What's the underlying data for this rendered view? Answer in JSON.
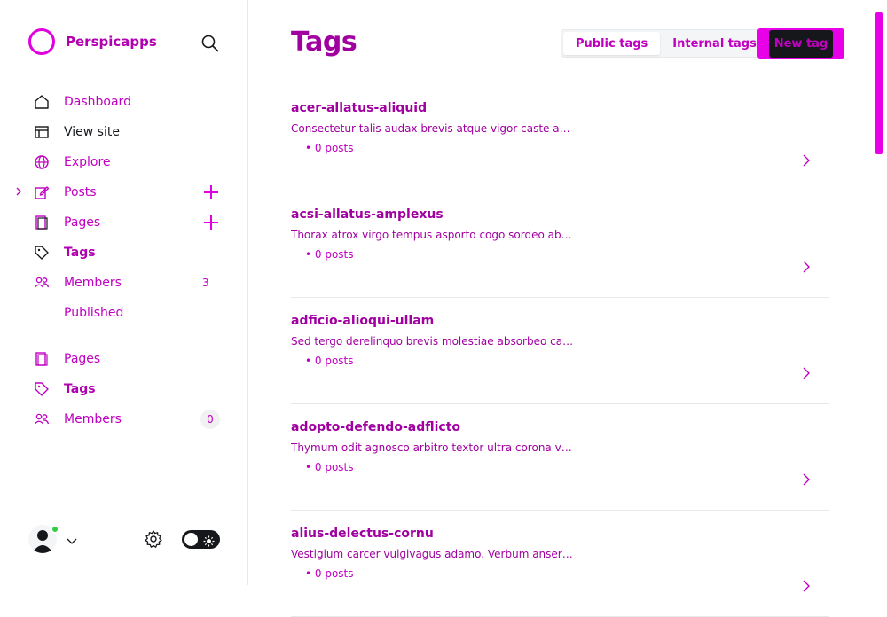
{
  "brand": {
    "name": "Perspicapps"
  },
  "sidebar": {
    "items": [
      {
        "label": "Dashboard"
      },
      {
        "label": "View site"
      },
      {
        "label": "Explore"
      },
      {
        "label": "Posts"
      },
      {
        "label": "Pages"
      },
      {
        "label": "Tags"
      },
      {
        "label": "Members",
        "count": "3"
      }
    ],
    "sub_items": [
      {
        "label": "Published"
      }
    ],
    "bottom_items": [
      {
        "label": "Pages"
      },
      {
        "label": "Tags"
      },
      {
        "label": "Members",
        "count": "0"
      }
    ]
  },
  "header": {
    "title": "Tags",
    "segments": [
      {
        "label": "Public tags"
      },
      {
        "label": "Internal tags"
      }
    ],
    "new_tag_label": "New tag"
  },
  "tags": [
    {
      "name": "acer-allatus-aliquid",
      "description": "Consectetur talis audax brevis atque vigor caste acie...",
      "count": "• 0 posts"
    },
    {
      "name": "acsi-allatus-amplexus",
      "description": "Thorax atrox virgo tempus asporto cogo sordeo abs...",
      "count": "• 0 posts"
    },
    {
      "name": "adficio-alioqui-ullam",
      "description": "Sed tergo derelinquo brevis molestiae absorbeo cat...",
      "count": "• 0 posts"
    },
    {
      "name": "adopto-defendo-adflicto",
      "description": "Thymum odit agnosco arbitro textor ultra corona va...",
      "count": "• 0 posts"
    },
    {
      "name": "alius-delectus-cornu",
      "description": "Vestigium carcer vulgivagus adamo. Verbum anser a...",
      "count": "• 0 posts"
    }
  ]
}
